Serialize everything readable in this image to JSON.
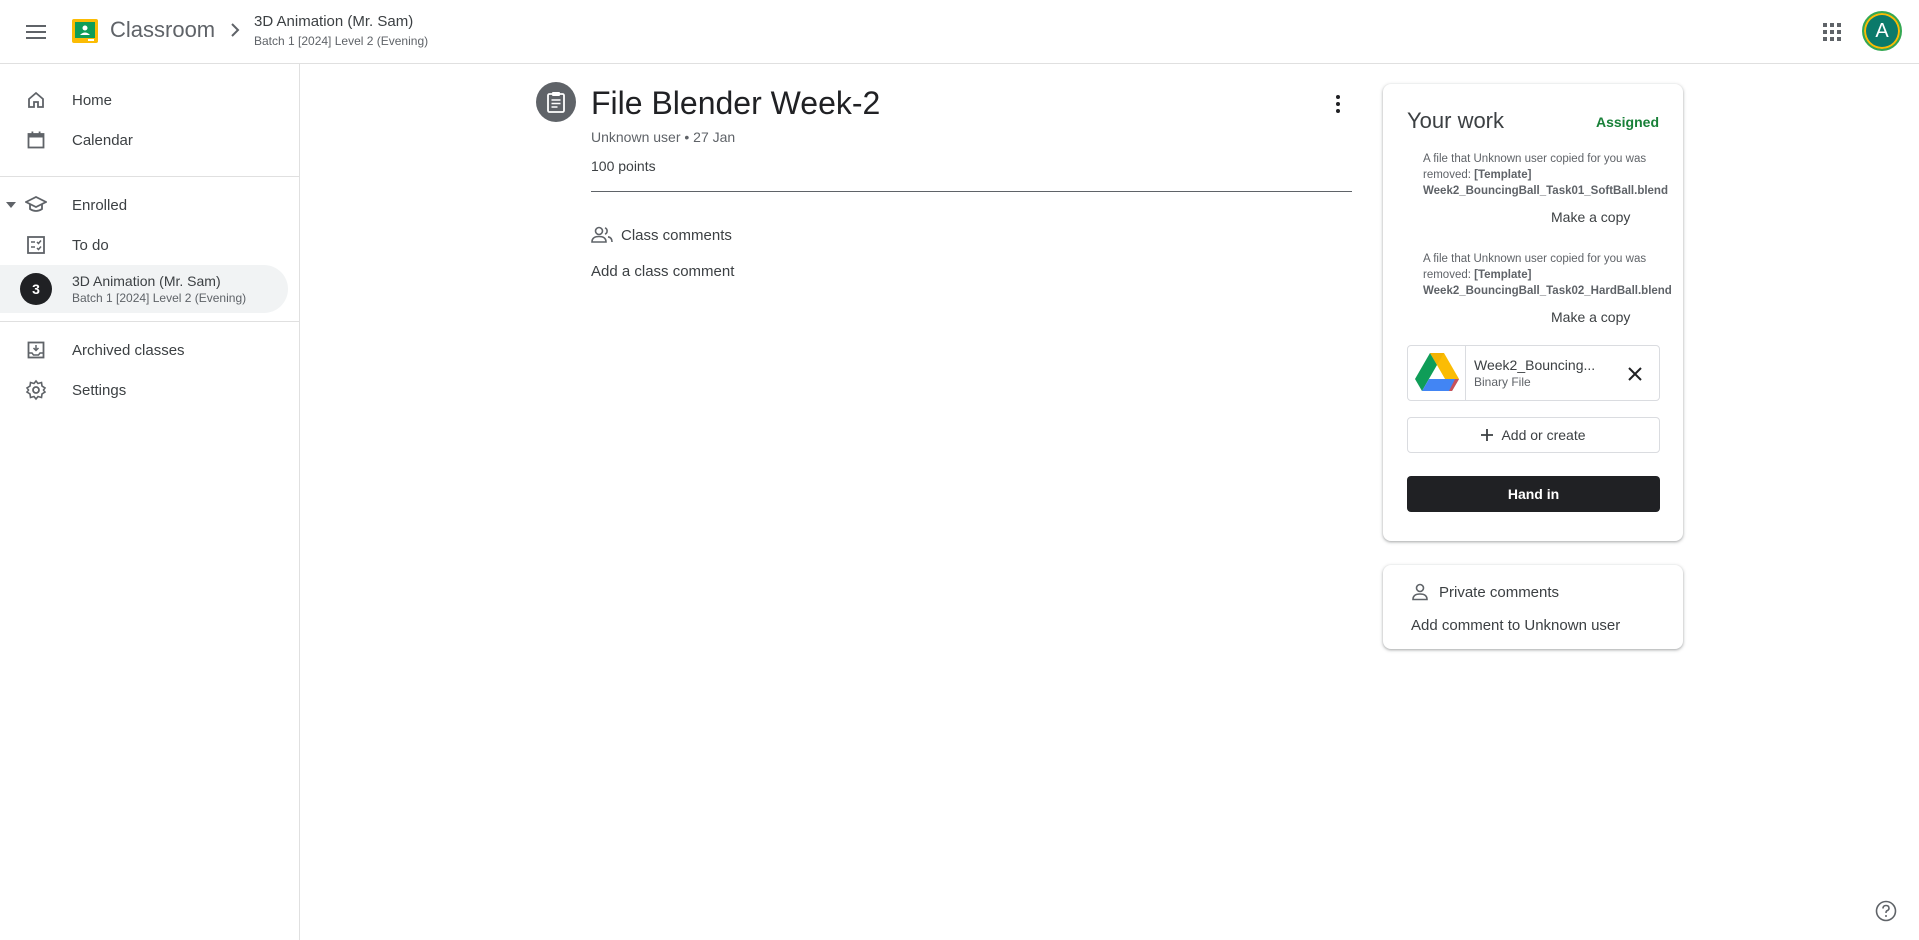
{
  "header": {
    "app_name": "Classroom",
    "class_title": "3D Animation (Mr. Sam)",
    "class_section": "Batch 1 [2024] Level 2 (Evening)",
    "avatar_letter": "A"
  },
  "sidebar": {
    "home": "Home",
    "calendar": "Calendar",
    "enrolled": "Enrolled",
    "todo": "To do",
    "class_badge": "3",
    "class_title": "3D Animation (Mr. Sam)",
    "class_section": "Batch 1 [2024] Level 2 (Evening)",
    "archived": "Archived classes",
    "settings": "Settings"
  },
  "assignment": {
    "title": "File Blender Week-2",
    "meta": "Unknown user • 27 Jan",
    "points": "100 points",
    "comments_label": "Class comments",
    "add_comment": "Add a class comment"
  },
  "your_work": {
    "title": "Your work",
    "status": "Assigned",
    "removed_files": [
      {
        "prefix": "A file that Unknown user copied for you was removed: ",
        "name": "[Template] Week2_BouncingBall_Task01_SoftBall.blend",
        "action": "Make a copy"
      },
      {
        "prefix": "A file that Unknown user copied for you was removed: ",
        "name": "[Template] Week2_BouncingBall_Task02_HardBall.blend",
        "action": "Make a copy"
      }
    ],
    "attachment": {
      "name": "Week2_Bouncing...",
      "type": "Binary File"
    },
    "add_or_create": "Add or create",
    "hand_in": "Hand in"
  },
  "private_comments": {
    "label": "Private comments",
    "add": "Add comment to Unknown user"
  },
  "colors": {
    "assigned_status": "#188038",
    "hand_in_bg": "#202124",
    "avatar_bg": "#0b7a6a"
  }
}
